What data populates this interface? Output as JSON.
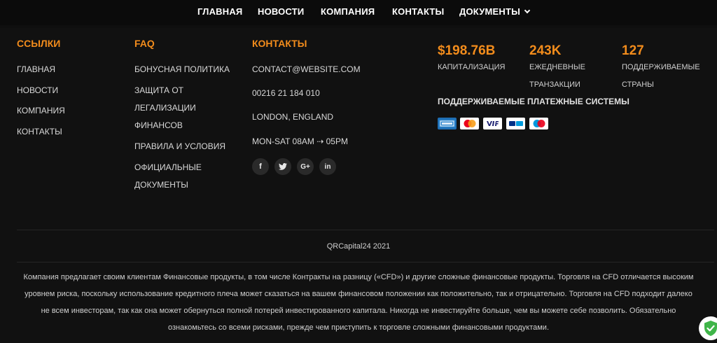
{
  "topnav": {
    "items": [
      {
        "label": "ГЛАВНАЯ"
      },
      {
        "label": "НОВОСТИ"
      },
      {
        "label": "КОМПАНИЯ"
      },
      {
        "label": "КОНТАКТЫ"
      },
      {
        "label": "ДОКУМЕНТЫ"
      }
    ]
  },
  "links": {
    "title": "ССЫЛКИ",
    "items": [
      "ГЛАВНАЯ",
      "НОВОСТИ",
      "КОМПАНИЯ",
      "КОНТАКТЫ"
    ]
  },
  "faq": {
    "title": "FAQ",
    "items": [
      [
        "БОНУСНАЯ ПОЛИТИКА"
      ],
      [
        "ЗАЩИТА ОТ",
        "ЛЕГАЛИЗАЦИИ",
        "ФИНАНСОВ"
      ],
      [
        "ПРАВИЛА И УСЛОВИЯ"
      ],
      [
        "ОФИЦИАЛЬНЫЕ",
        "ДОКУМЕНТЫ"
      ]
    ]
  },
  "contacts": {
    "title": "КОНТАКТЫ",
    "email": "CONTACT@WEBSITE.COM",
    "phone": "00216 21 184 010",
    "address": "LONDON, ENGLAND",
    "hours": "MON-SAT 08AM ⇢ 05PM",
    "social": [
      "facebook-icon",
      "twitter-icon",
      "google-plus-icon",
      "linkedin-icon"
    ]
  },
  "stats": [
    {
      "value": "$198.76B",
      "label": [
        "КАПИТАЛИЗАЦИЯ"
      ]
    },
    {
      "value": "243K",
      "label": [
        "ЕЖЕДНЕВНЫЕ",
        "ТРАНЗАКЦИИ"
      ]
    },
    {
      "value": "127",
      "label": [
        "ПОДДЕРЖИВАЕМЫЕ",
        "СТРАНЫ"
      ]
    }
  ],
  "payments": {
    "title": "ПОДДЕРЖИВАЕМЫЕ ПЛАТЕЖНЫЕ СИСТЕМЫ",
    "cards": [
      "amex-card-icon",
      "mastercard-card-icon",
      "visa-card-icon",
      "paypal-card-icon",
      "maestro-card-icon"
    ]
  },
  "copyright": "QRCapital24 2021",
  "disclaimer": "Компания предлагает своим клиентам Финансовые продукты, в том числе Контракты на разницу («CFD») и другие сложные финансовые продукты. Торговля на CFD отличается высоким уровнем риска, поскольку использование кредитного плеча может сказаться на вашем финансовом положении как положительно, так и отрицательно. Торговля на CFD подходит далеко не всем инвесторам, так как она может обернуться полной потерей инвестированного капитала. Никогда не инвестируйте больше, чем вы можете себе позволить. Обязательно ознакомьтесь со всеми рисками, прежде чем приступить к торговле сложными финансовыми продуктами.",
  "colors": {
    "accent": "#f28c1c",
    "background": "#111111"
  }
}
